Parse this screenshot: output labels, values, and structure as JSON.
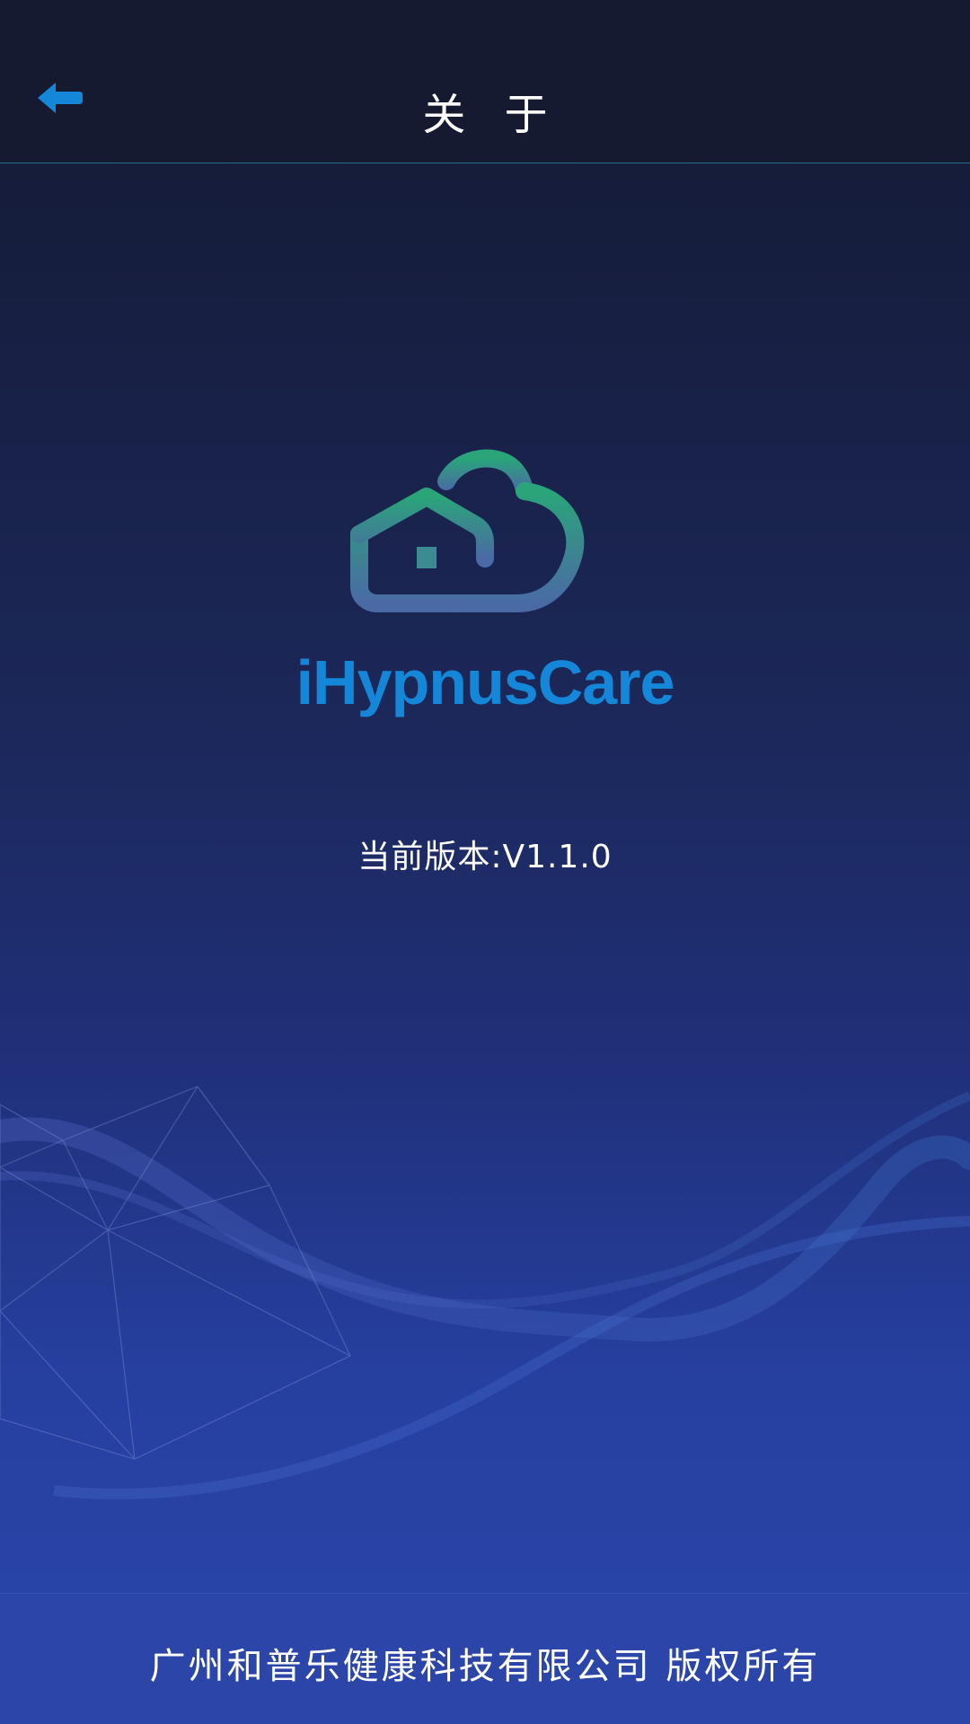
{
  "header": {
    "back_icon": "back-arrow-icon",
    "title": "关 于"
  },
  "main": {
    "logo_icon": "cloud-house-logo-icon",
    "app_name": "iHypnusCare",
    "version": "当前版本:V1.1.0"
  },
  "footer": {
    "copyright": "广州和普乐健康科技有限公司 版权所有"
  },
  "colors": {
    "accent": "#1487d9",
    "logo_gradient_top": "#2aa579",
    "logo_gradient_bottom": "#4a6aa5",
    "header_bg": "#151a31",
    "footer_bg": "#2b45a8"
  }
}
